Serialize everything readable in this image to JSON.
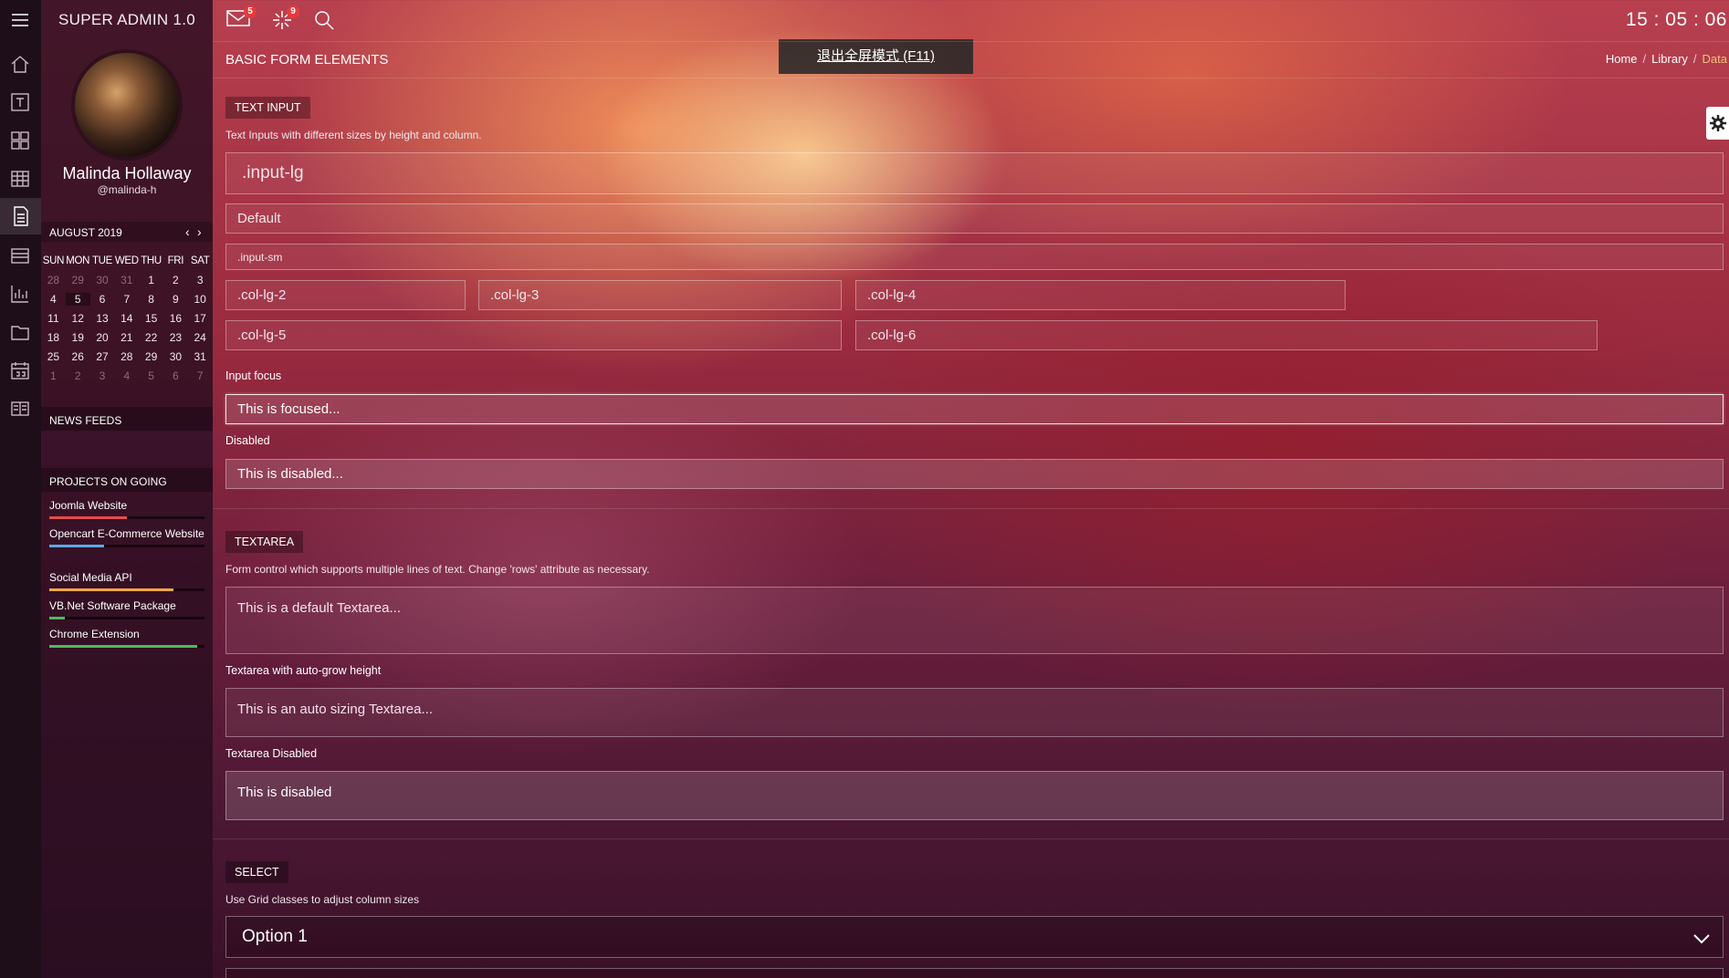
{
  "app": {
    "title": "SUPER ADMIN 1.0"
  },
  "topbar": {
    "mail_count": "5",
    "alerts_count": "9",
    "clock": "15 : 05 : 06",
    "fullscreen_tip": "退出全屏模式 (F11)"
  },
  "user": {
    "name": "Malinda Hollaway",
    "handle": "@malinda-h"
  },
  "calendar": {
    "month": "AUGUST 2019",
    "prev": "‹",
    "next": "›",
    "days_of_week": [
      "SUN",
      "MON",
      "TUE",
      "WED",
      "THU",
      "FRI",
      "SAT"
    ],
    "weeks": [
      [
        "28",
        "29",
        "30",
        "31",
        "1",
        "2",
        "3"
      ],
      [
        "4",
        "5",
        "6",
        "7",
        "8",
        "9",
        "10"
      ],
      [
        "11",
        "12",
        "13",
        "14",
        "15",
        "16",
        "17"
      ],
      [
        "18",
        "19",
        "20",
        "21",
        "22",
        "23",
        "24"
      ],
      [
        "25",
        "26",
        "27",
        "28",
        "29",
        "30",
        "31"
      ],
      [
        "1",
        "2",
        "3",
        "4",
        "5",
        "6",
        "7"
      ]
    ]
  },
  "news": {
    "heading": "NEWS FEEDS"
  },
  "projects": {
    "heading": "PROJECTS ON GOING",
    "items": [
      {
        "label": "Joomla Website",
        "progress": 0.5,
        "color": "#e74c4c"
      },
      {
        "label": "Opencart E-Commerce Website",
        "progress": 0.35,
        "color": "#5aa9e6"
      },
      {
        "label": "Social Media API",
        "progress": 0.8,
        "color": "#f0a64a"
      },
      {
        "label": "VB.Net Software Package",
        "progress": 0.1,
        "color": "#4cbb5a"
      },
      {
        "label": "Chrome Extension",
        "progress": 0.95,
        "color": "#4cbb5a"
      }
    ]
  },
  "page": {
    "title": "BASIC FORM ELEMENTS",
    "breadcrumb": [
      "Home",
      "Library",
      "Data"
    ]
  },
  "text_input": {
    "tag": "TEXT INPUT",
    "help": "Text Inputs with different sizes by height and column.",
    "input_lg": ".input-lg",
    "input_default": "Default",
    "input_sm": ".input-sm",
    "col_lg_2": ".col-lg-2",
    "col_lg_3": ".col-lg-3",
    "col_lg_4": ".col-lg-4",
    "col_lg_5": ".col-lg-5",
    "col_lg_6": ".col-lg-6",
    "focus_label": "Input focus",
    "focus_value": "This is focused...",
    "disabled_label": "Disabled",
    "disabled_value": "This is disabled..."
  },
  "textarea": {
    "tag": "TEXTAREA",
    "help": "Form control which supports multiple lines of text. Change 'rows' attribute as necessary.",
    "default_placeholder": "This is a default Textarea...",
    "autogrow_label": "Textarea with auto-grow height",
    "autogrow_placeholder": "This is an auto sizing Textarea...",
    "disabled_label": "Textarea Disabled",
    "disabled_value": "This is disabled"
  },
  "select": {
    "tag": "SELECT",
    "help": "Use Grid classes to adjust column sizes",
    "selected": "Option 1"
  }
}
